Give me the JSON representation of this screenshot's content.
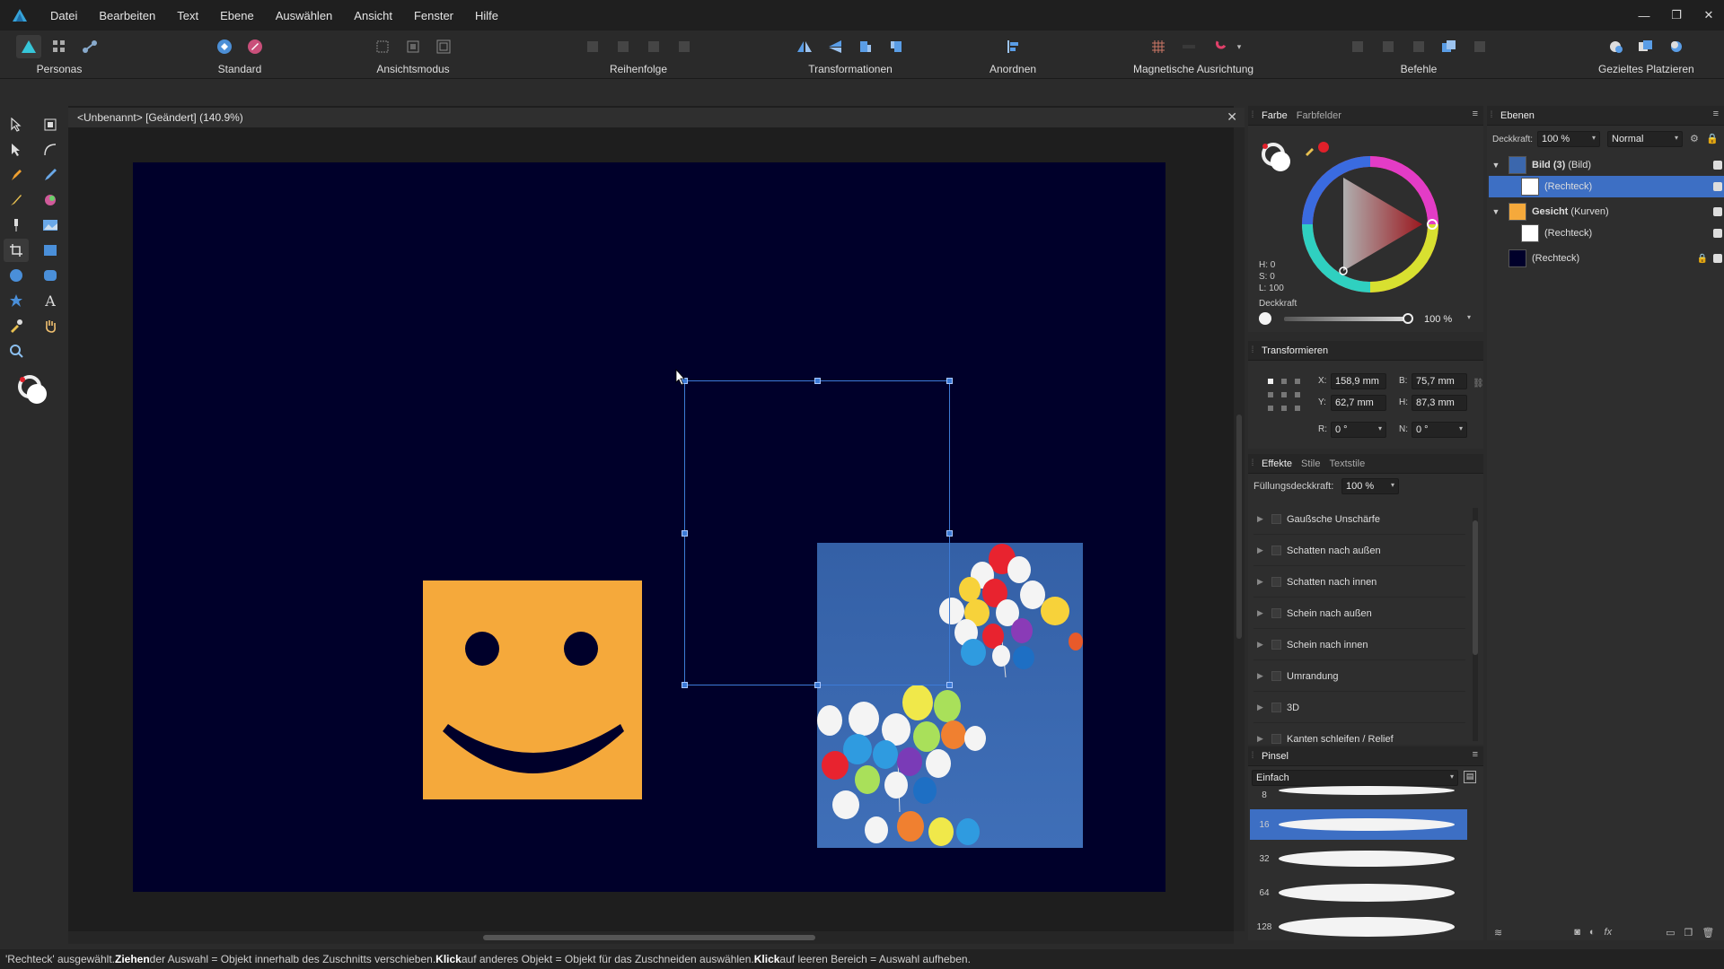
{
  "menubar": {
    "items": [
      "Datei",
      "Bearbeiten",
      "Text",
      "Ebene",
      "Auswählen",
      "Ansicht",
      "Fenster",
      "Hilfe"
    ],
    "window_controls": [
      "—",
      "❐",
      "✕"
    ]
  },
  "toolbar": {
    "groups": [
      {
        "label": "Personas"
      },
      {
        "label": "Standard"
      },
      {
        "label": "Ansichtsmodus"
      },
      {
        "label": "Reihenfolge"
      },
      {
        "label": "Transformationen"
      },
      {
        "label": "Anordnen"
      },
      {
        "label": "Magnetische Ausrichtung"
      },
      {
        "label": "Befehle"
      },
      {
        "label": "Gezieltes Platzieren"
      }
    ]
  },
  "document": {
    "tab_title": "<Unbenannt> [Geändert] (140.9%)",
    "close_glyph": "✕"
  },
  "color_panel": {
    "tabs": [
      "Farbe",
      "Farbfelder"
    ],
    "hsl": {
      "h": "H: 0",
      "s": "S: 0",
      "l": "L: 100"
    },
    "opacity_label": "Deckkraft",
    "opacity_value": "100 %",
    "accent": "#e0202a"
  },
  "transform_panel": {
    "title": "Transformieren",
    "x_label": "X:",
    "x_value": "158,9 mm",
    "y_label": "Y:",
    "y_value": "62,7 mm",
    "w_label": "B:",
    "w_value": "75,7 mm",
    "h_label": "H:",
    "h_value": "87,3 mm",
    "r_label": "R:",
    "r_value": "0 °",
    "s_label": "N:",
    "s_value": "0 °"
  },
  "effects_panel": {
    "tabs": [
      "Effekte",
      "Stile",
      "Textstile"
    ],
    "fill_opacity_label": "Füllungsdeckkraft:",
    "fill_opacity_value": "100 %",
    "effects": [
      "Gaußsche Unschärfe",
      "Schatten nach außen",
      "Schatten nach innen",
      "Schein nach außen",
      "Schein nach innen",
      "Umrandung",
      "3D",
      "Kanten schleifen / Relief"
    ]
  },
  "brush_panel": {
    "title": "Pinsel",
    "category": "Einfach",
    "sizes": [
      "8",
      "16",
      "32",
      "64",
      "128"
    ],
    "selected_size": "16"
  },
  "layers_panel": {
    "title": "Ebenen",
    "opacity_label": "Deckkraft:",
    "opacity_value": "100 %",
    "blend_mode": "Normal",
    "layers": [
      {
        "name": "Bild (3)",
        "type": "(Bild)",
        "group": true
      },
      {
        "name": "(Rechteck)",
        "type": "",
        "child": true,
        "selected": true
      },
      {
        "name": "Gesicht",
        "type": "(Kurven)",
        "group": true
      },
      {
        "name": "(Rechteck)",
        "type": "",
        "child": true
      },
      {
        "name": "(Rechteck)",
        "type": "",
        "locked": true
      }
    ]
  },
  "status": {
    "part1": "'Rechteck' ausgewählt. ",
    "b1": "Ziehen",
    "part2": " der Auswahl = Objekt innerhalb des Zuschnitts verschieben. ",
    "b2": "Klick",
    "part3": " auf anderes Objekt = Objekt für das Zuschneiden auswählen. ",
    "b3": "Klick",
    "part4": " auf leeren Bereich = Auswahl aufheben."
  },
  "colors": {
    "canvas_bg": "#00002a",
    "smiley": "#f5a93b",
    "selection": "#3d7bd6",
    "photo_sky": "#3b67ad"
  }
}
